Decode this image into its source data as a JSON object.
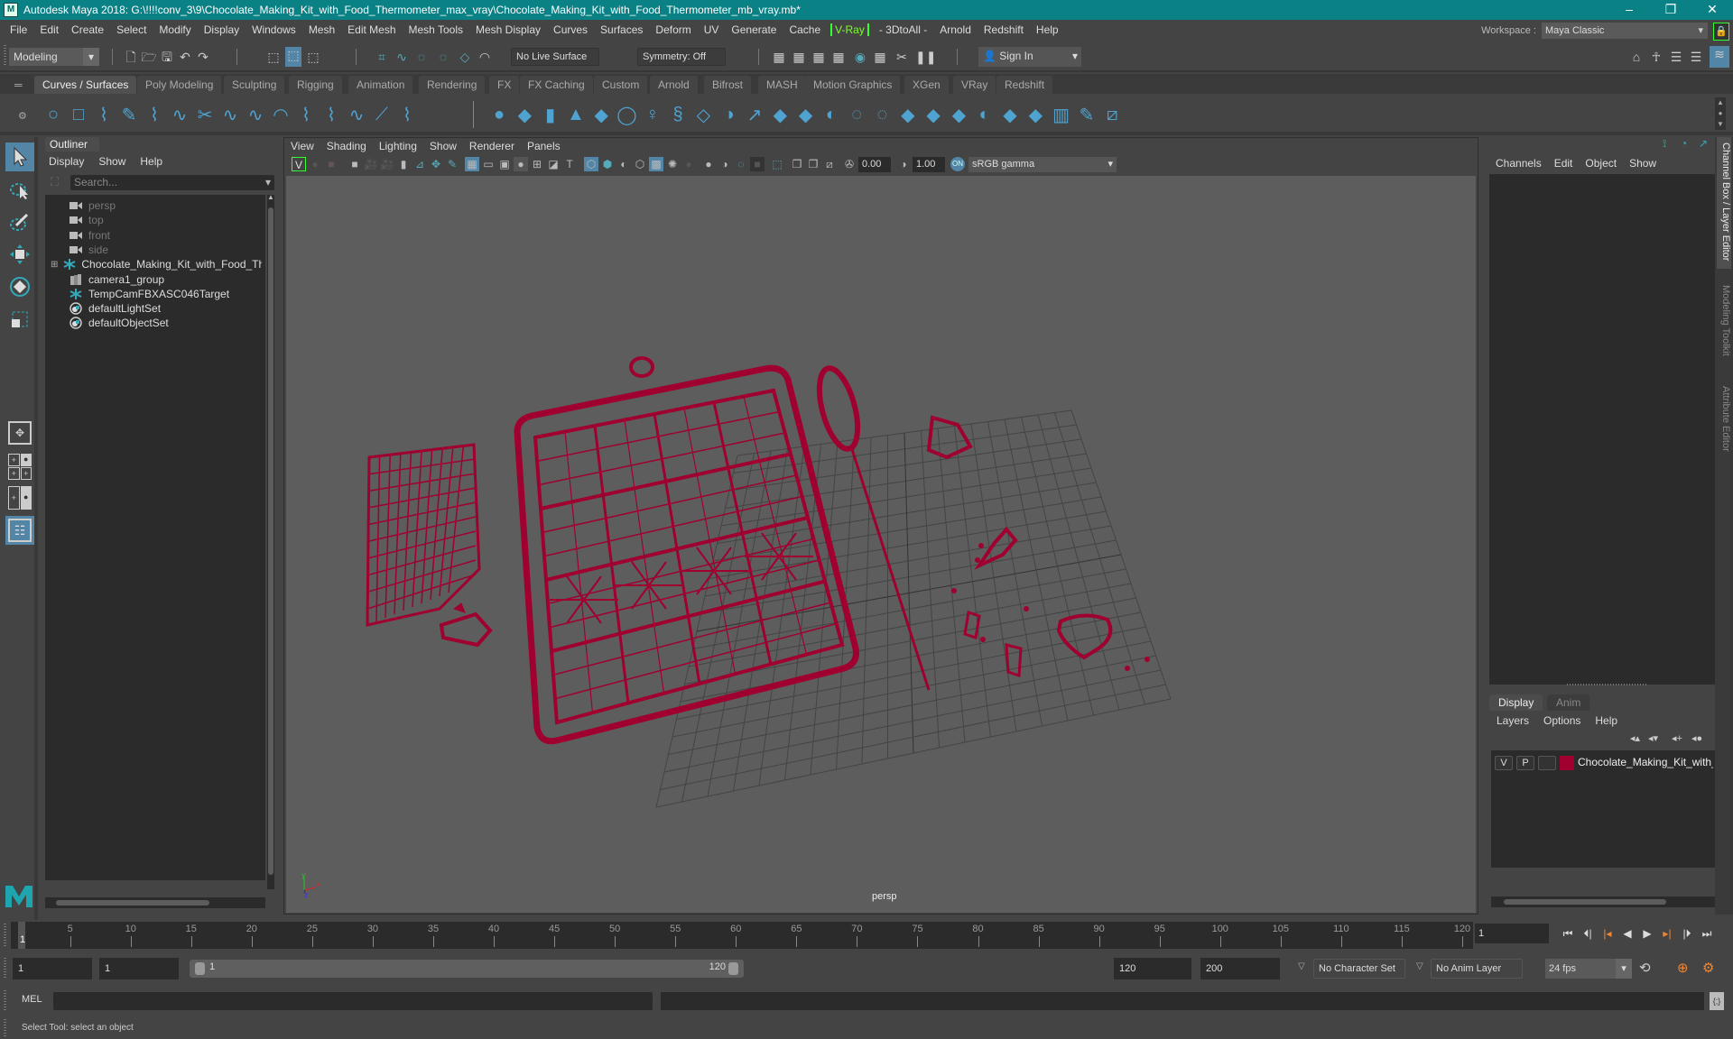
{
  "window": {
    "title": "Autodesk Maya 2018: G:\\!!!!conv_3\\9\\Chocolate_Making_Kit_with_Food_Thermometer_max_vray\\Chocolate_Making_Kit_with_Food_Thermometer_mb_vray.mb*",
    "minimize": "–",
    "maximize": "❐",
    "close": "✕"
  },
  "menubar": {
    "items": [
      "File",
      "Edit",
      "Create",
      "Select",
      "Modify",
      "Display",
      "Windows",
      "Mesh",
      "Edit Mesh",
      "Mesh Tools",
      "Mesh Display",
      "Curves",
      "Surfaces",
      "Deform",
      "UV",
      "Generate",
      "Cache"
    ],
    "vray": "V-Ray",
    "items2": [
      "- 3DtoAll -",
      "Arnold",
      "Redshift",
      "Help"
    ]
  },
  "workspace": {
    "label": "Workspace :",
    "value": "Maya Classic"
  },
  "statusline": {
    "mode": "Modeling",
    "live_surface": "No Live Surface",
    "symmetry": "Symmetry: Off",
    "sign_in": "Sign In"
  },
  "shelf": {
    "tabs": [
      "Curves / Surfaces",
      "Poly Modeling",
      "Sculpting",
      "Rigging",
      "Animation",
      "Rendering",
      "FX",
      "FX Caching",
      "Custom",
      "Arnold",
      "Bifrost",
      "MASH",
      "Motion Graphics",
      "XGen",
      "VRay",
      "Redshift"
    ],
    "active_tab": "Curves / Surfaces"
  },
  "outliner": {
    "title": "Outliner",
    "menu": [
      "Display",
      "Show",
      "Help"
    ],
    "search_placeholder": "Search...",
    "items": [
      {
        "name": "persp",
        "icon": "camera-icon",
        "dim": true
      },
      {
        "name": "top",
        "icon": "camera-icon",
        "dim": true
      },
      {
        "name": "front",
        "icon": "camera-icon",
        "dim": true
      },
      {
        "name": "side",
        "icon": "camera-icon",
        "dim": true
      },
      {
        "name": "Chocolate_Making_Kit_with_Food_Th",
        "icon": "transform-icon",
        "dim": false,
        "expandable": true
      },
      {
        "name": "camera1_group",
        "icon": "group-icon",
        "dim": false
      },
      {
        "name": "TempCamFBXASC046Target",
        "icon": "transform-icon",
        "dim": false
      },
      {
        "name": "defaultLightSet",
        "icon": "set-icon",
        "dim": false
      },
      {
        "name": "defaultObjectSet",
        "icon": "set-icon",
        "dim": false
      }
    ]
  },
  "viewport": {
    "menu": [
      "View",
      "Shading",
      "Lighting",
      "Show",
      "Renderer",
      "Panels"
    ],
    "exposure": "0.00",
    "gamma": "1.00",
    "color_space": "sRGB gamma",
    "camera": "persp",
    "axis": {
      "x": "x",
      "y": "y",
      "z": "z"
    },
    "wire_color": "#a0002f"
  },
  "channelbox": {
    "menu": [
      "Channels",
      "Edit",
      "Object",
      "Show"
    ]
  },
  "layers": {
    "tabs": [
      "Display",
      "Anim"
    ],
    "active_tab": "Display",
    "menu": [
      "Layers",
      "Options",
      "Help"
    ],
    "rows": [
      {
        "v": "V",
        "p": "P",
        "color": "#a0002f",
        "name": "Chocolate_Making_Kit_with_Fo"
      }
    ]
  },
  "side_tabs": [
    "Channel Box / Layer Editor",
    "Modeling Toolkit",
    "Attribute Editor"
  ],
  "timeline": {
    "ticks": [
      5,
      10,
      15,
      20,
      25,
      30,
      35,
      40,
      45,
      50,
      55,
      60,
      65,
      70,
      75,
      80,
      85,
      90,
      95,
      100,
      105,
      110,
      115,
      120
    ],
    "start": 1,
    "end": 120,
    "current_marker": "1",
    "current_frame": "1"
  },
  "range": {
    "start_field": "1",
    "anim_start": "1",
    "slider_start": "1",
    "slider_end": "120",
    "end_field": "120",
    "anim_end": "200",
    "character_set": "No Character Set",
    "anim_layer": "No Anim Layer",
    "fps": "24 fps"
  },
  "cmdline": {
    "label": "MEL"
  },
  "status": {
    "text": "Select Tool: select an object"
  }
}
